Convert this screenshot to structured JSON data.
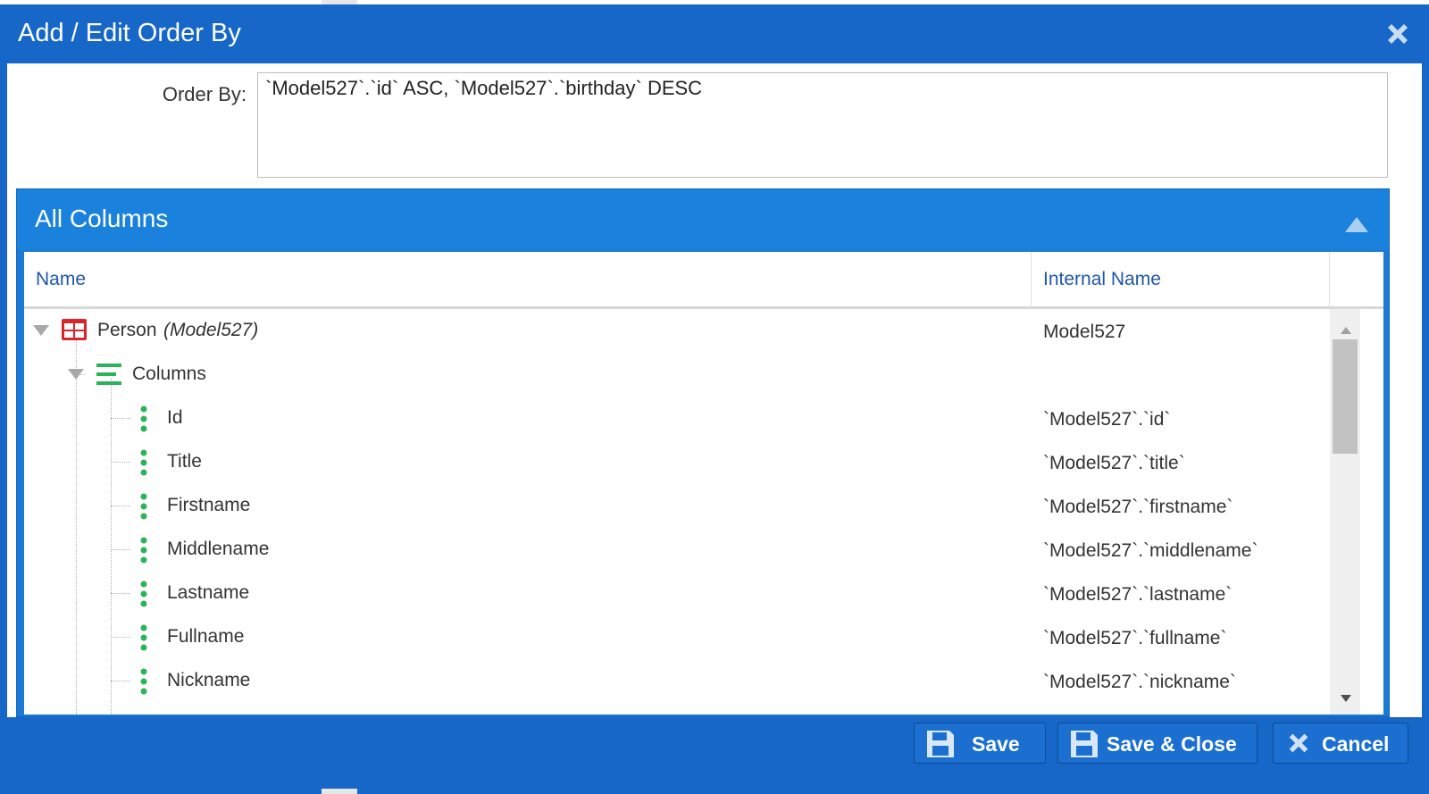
{
  "dialog": {
    "title": "Add / Edit Order By",
    "close_icon": "close-icon"
  },
  "order_by": {
    "label": "Order By:",
    "value": "`Model527`.`id` ASC, `Model527`.`birthday` DESC"
  },
  "panel": {
    "title": "All Columns",
    "collapse_icon": "chevron-up-icon"
  },
  "grid": {
    "headers": {
      "name": "Name",
      "internal_name": "Internal Name"
    },
    "root": {
      "name": "Person",
      "model": "(Model527)",
      "internal": "Model527",
      "icon": "table-icon"
    },
    "group": {
      "name": "Columns",
      "icon": "list-icon"
    },
    "columns": [
      {
        "name": "Id",
        "internal": "`Model527`.`id`"
      },
      {
        "name": "Title",
        "internal": "`Model527`.`title`"
      },
      {
        "name": "Firstname",
        "internal": "`Model527`.`firstname`"
      },
      {
        "name": "Middlename",
        "internal": "`Model527`.`middlename`"
      },
      {
        "name": "Lastname",
        "internal": "`Model527`.`lastname`"
      },
      {
        "name": "Fullname",
        "internal": "`Model527`.`fullname`"
      },
      {
        "name": "Nickname",
        "internal": "`Model527`.`nickname`"
      }
    ]
  },
  "footer": {
    "save": "Save",
    "save_close": "Save & Close",
    "cancel": "Cancel"
  },
  "colors": {
    "dialog_blue": "#1667c7",
    "panel_blue": "#1a82dc",
    "icon_green": "#2bb35a",
    "icon_red": "#d9262c",
    "header_text": "#1f57a8"
  }
}
